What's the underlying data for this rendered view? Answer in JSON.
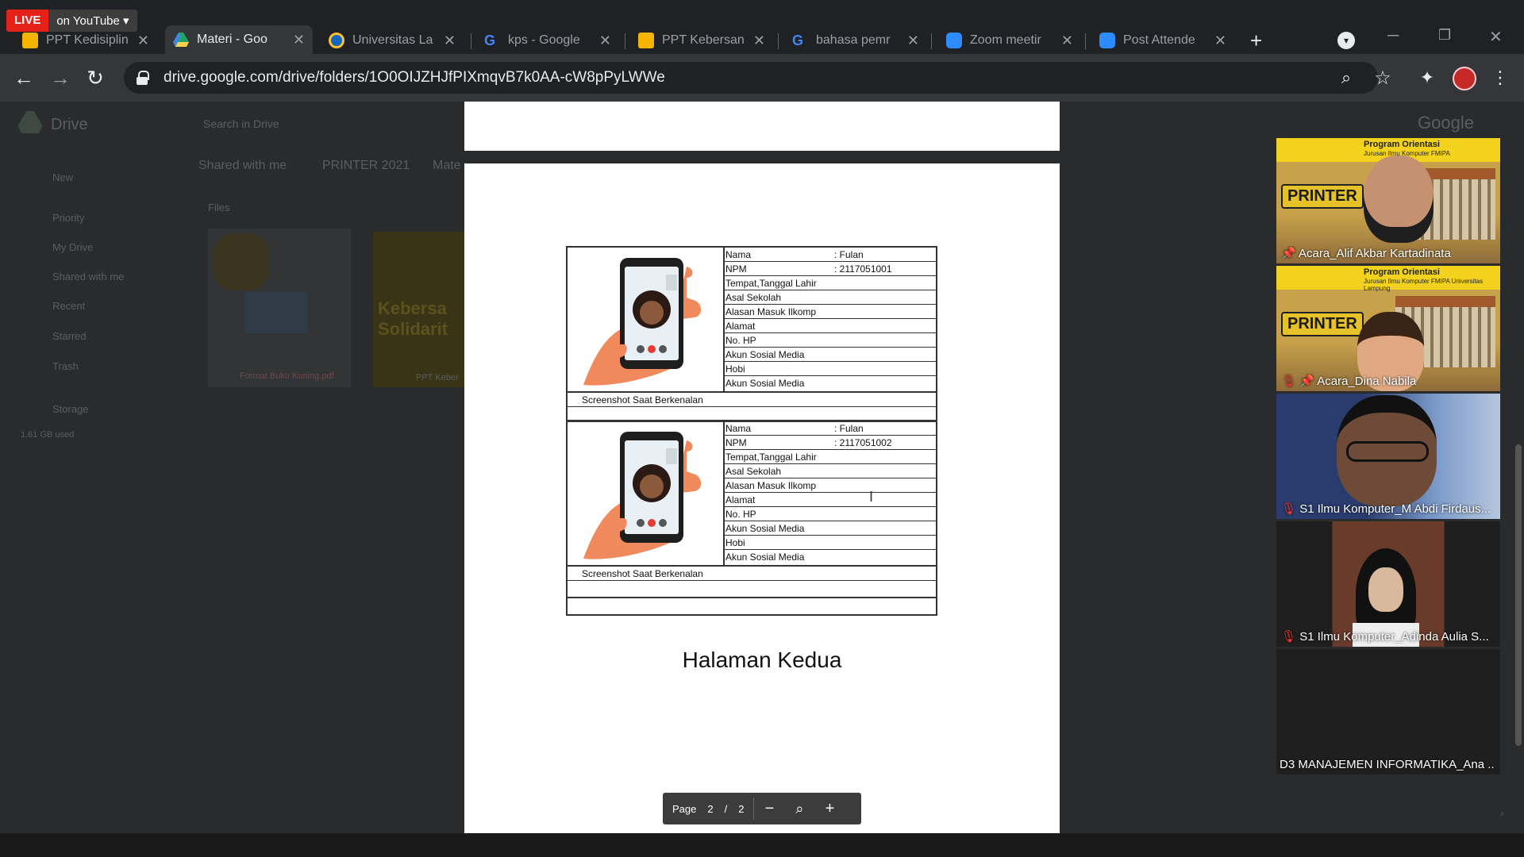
{
  "live_badge": {
    "live": "LIVE",
    "platform": "on YouTube"
  },
  "tabs": [
    {
      "label": "PPT Kedisiplin",
      "icon": "slides-icon"
    },
    {
      "label": "Materi - Goo",
      "icon": "drive-icon",
      "active": true
    },
    {
      "label": "Universitas La",
      "icon": "university-icon"
    },
    {
      "label": "kps - Google",
      "icon": "google-icon"
    },
    {
      "label": "PPT Kebersan",
      "icon": "slides-icon"
    },
    {
      "label": "bahasa pemr",
      "icon": "google-icon"
    },
    {
      "label": "Zoom meetir",
      "icon": "zoom-icon"
    },
    {
      "label": "Post Attende",
      "icon": "zoom-icon"
    }
  ],
  "address_bar": {
    "url": "drive.google.com/drive/folders/1O0OIJZHJfPIXmqvB7k0AA-cW8pPyLWWe"
  },
  "drive": {
    "app_name": "Drive",
    "search_placeholder": "Search in Drive",
    "breadcrumb": [
      "Shared with me",
      "PRINTER 2021",
      "Mate"
    ],
    "section": "Files",
    "nav": [
      "New",
      "Priority",
      "My Drive",
      "Shared with me",
      "Recent",
      "Starred",
      "Trash",
      "Storage"
    ],
    "storage_used": "1.61 GB used",
    "files": [
      "Format Buku Kuning.pdf",
      "PPT Keber"
    ],
    "thumb_text": "Kebersa Solidarit",
    "google_label": "Google"
  },
  "document": {
    "forms": [
      {
        "rows": [
          {
            "label": "Nama",
            "value": ": Fulan"
          },
          {
            "label": "NPM",
            "value": ": 2117051001"
          },
          {
            "label": "Tempat,Tanggal Lahir",
            "value": ""
          },
          {
            "label": "Asal Sekolah",
            "value": ""
          },
          {
            "label": "Alasan Masuk Ilkomp",
            "value": ""
          },
          {
            "label": "Alamat",
            "value": ""
          },
          {
            "label": "No. HP",
            "value": ""
          },
          {
            "label": "Akun Sosial Media",
            "value": ""
          },
          {
            "label": "Hobi",
            "value": ""
          },
          {
            "label": "Akun Sosial Media",
            "value": ""
          }
        ],
        "caption": "Screenshot Saat Berkenalan"
      },
      {
        "rows": [
          {
            "label": "Nama",
            "value": ": Fulan"
          },
          {
            "label": "NPM",
            "value": ": 2117051002"
          },
          {
            "label": "Tempat,Tanggal Lahir",
            "value": ""
          },
          {
            "label": "Asal Sekolah",
            "value": ""
          },
          {
            "label": "Alasan Masuk Ilkomp",
            "value": ""
          },
          {
            "label": "Alamat",
            "value": ""
          },
          {
            "label": "No. HP",
            "value": ""
          },
          {
            "label": "Akun Sosial Media",
            "value": ""
          },
          {
            "label": "Hobi",
            "value": ""
          },
          {
            "label": "Akun Sosial Media",
            "value": ""
          }
        ],
        "caption": "Screenshot Saat Berkenalan"
      }
    ],
    "page_caption": "Halaman Kedua"
  },
  "pager": {
    "label": "Page",
    "current": "2",
    "separator": "/",
    "total": "2"
  },
  "participants": [
    {
      "name": "Acara_Alif Akbar Kartadinata",
      "banner_title": "Program Orientasi",
      "banner_sub": "Jurusan Ilmu Komputer FMIPA",
      "banner_logo": "PRINTER",
      "pinned": true
    },
    {
      "name": "Acara_Dina Nabila",
      "banner_title": "Program Orientasi",
      "banner_sub": "Jurusan Ilmu Komputer FMIPA Universitas Lampung",
      "banner_logo": "PRINTER",
      "pinned": true,
      "muted": true
    },
    {
      "name": "S1 Ilmu Komputer_M Abdi Firdaus...",
      "muted": true
    },
    {
      "name": "S1 Ilmu Komputer_Adinda Aulia S...",
      "muted": true
    },
    {
      "name": "D3 MANAJEMEN INFORMATIKA_Ana ..."
    }
  ],
  "colors": {
    "live_red": "#e62117",
    "chrome_dark": "#202124",
    "toolbar": "#35363a",
    "mute_red": "#e53935"
  }
}
